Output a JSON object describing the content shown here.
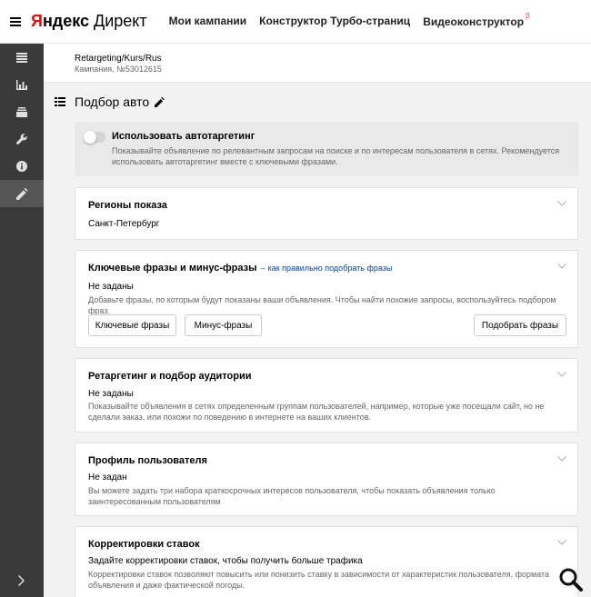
{
  "header": {
    "logo_ya": "Я",
    "logo_ndeks": "ндекс",
    "logo_product": "Директ",
    "nav": [
      {
        "label": "Мои кампании"
      },
      {
        "label": "Конструктор Турбо-страниц"
      },
      {
        "label": "Видеоконструктор",
        "badge": "β"
      }
    ]
  },
  "rail": {
    "items": [
      "list-icon",
      "bar-chart-icon",
      "stack-icon",
      "wrench-icon",
      "info-icon",
      "pencil-icon"
    ],
    "active": "pencil-icon",
    "bottom": "chevron-right-icon"
  },
  "campaign": {
    "name": "Retargeting/Kurs/Rus",
    "number": "Кампания, №53012615"
  },
  "page": {
    "title": "Подбор авто"
  },
  "autotargeting": {
    "title": "Использовать автотаргетинг",
    "description": "Показывайте объявление по релевантным запросам на поиске и по интересам пользователя в сетях. Рекомендуется использовать автотаргетинг вместе с ключевыми фразами.",
    "enabled": false
  },
  "regions": {
    "title": "Регионы показа",
    "value": "Санкт-Петербург"
  },
  "keywords": {
    "title": "Ключевые фразы и минус-фразы",
    "dash": "–",
    "help_link": "как правильно подобрать фразы",
    "value": "Не заданы",
    "description": "Добавьте фразы, по которым будут показаны ваши объявления. Чтобы найти похожие запросы, воспользуйтесь подбором фраз.",
    "btn_keywords": "Ключевые фразы",
    "btn_minus": "Минус-фразы",
    "btn_pick": "Подобрать фразы"
  },
  "retargeting": {
    "title": "Ретаргетинг и подбор аудитории",
    "value": "Не заданы",
    "description": "Показывайте объявления в сетях определенным группам пользователей, например, которые уже посещали сайт, но не сделали заказ, или похожи по поведению в интернете на ваших клиентов."
  },
  "profile": {
    "title": "Профиль пользователя",
    "value": "Не задан",
    "description": "Вы можете задать три набора краткосрочных интересов пользователя, чтобы показать объявления только заинтересованным пользователям"
  },
  "bids": {
    "title": "Корректировки ставок",
    "value": "Задайте корректировки ставок, чтобы получить больше трафика",
    "description": "Корректировки ставок позволяют повысить или понизить ставку в зависимости от характеристик пользователя, формата объявления и даже фактической погоды."
  },
  "colors": {
    "accent_red": "#ff0000",
    "link_blue": "#0044bb",
    "rail_bg": "#3a3a3a"
  }
}
